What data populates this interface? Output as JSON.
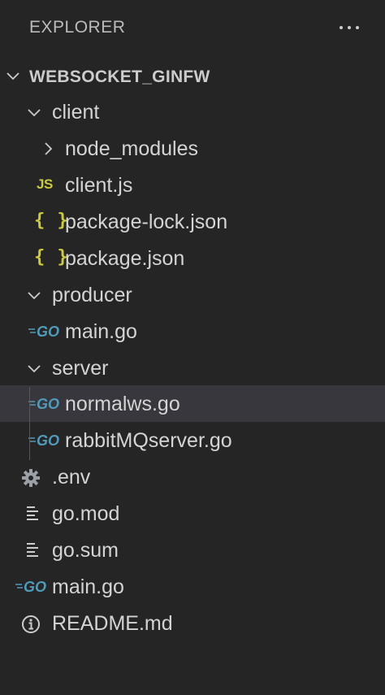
{
  "explorer": {
    "title": "EXPLORER",
    "more_icon": "ellipsis-icon"
  },
  "tree": {
    "root": {
      "label": "WEBSOCKET_GINFW",
      "expanded": true
    },
    "client": {
      "label": "client",
      "expanded": true
    },
    "node_modules": {
      "label": "node_modules",
      "expanded": false
    },
    "client_js": {
      "label": "client.js",
      "icon_text": "JS"
    },
    "package_lock": {
      "label": "package-lock.json",
      "icon_text": "{ }"
    },
    "package_json": {
      "label": "package.json",
      "icon_text": "{ }"
    },
    "producer": {
      "label": "producer",
      "expanded": true
    },
    "producer_main": {
      "label": "main.go"
    },
    "server": {
      "label": "server",
      "expanded": true
    },
    "normalws": {
      "label": "normalws.go",
      "selected": true
    },
    "rabbitmq": {
      "label": "rabbitMQserver.go"
    },
    "env": {
      "label": ".env"
    },
    "go_mod": {
      "label": "go.mod"
    },
    "go_sum": {
      "label": "go.sum"
    },
    "main_go": {
      "label": "main.go"
    },
    "readme": {
      "label": "README.md"
    }
  },
  "colors": {
    "background": "#252526",
    "selected_row": "#37373d",
    "go_icon": "#519aba",
    "json_js_icon": "#cbcb41",
    "text": "#d4d4d4"
  }
}
